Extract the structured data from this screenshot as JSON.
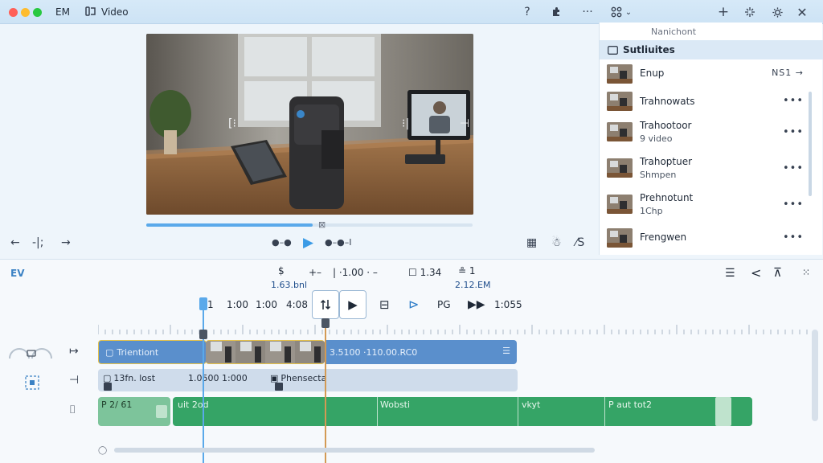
{
  "window": {
    "app_name": "EM",
    "tab_label": "Video",
    "tab_icon": "film-icon"
  },
  "toolbar": {
    "help_icon": "help-icon",
    "extension_icon": "puzzle-icon",
    "more_icon": "more-horizontal-icon",
    "layout_icon": "grid-layout-icon",
    "add_icon": "plus-icon",
    "effects_icon": "sparkle-icon",
    "settings_icon": "gear-icon",
    "close_icon": "close-icon"
  },
  "preview": {
    "progress_fraction": 0.51,
    "controls": {
      "back_label": "←",
      "split_label": "-|;",
      "forward_label": "→",
      "prev_label": "●–●",
      "next_label": "●–●–I"
    },
    "right_tools": [
      "▦",
      "☃",
      "⁄S"
    ]
  },
  "panel": {
    "caption": "Nanichont",
    "header": "Sutliuites",
    "header_icon": "folder-icon",
    "items": [
      {
        "title": "Enup",
        "sub": "",
        "trailing": "NS1 →"
      },
      {
        "title": "Trahnowats",
        "sub": "",
        "trailing": "•••"
      },
      {
        "title": "Trahootoor",
        "sub": "9 video",
        "trailing": "•••"
      },
      {
        "title": "Trahoptuer",
        "sub": "Shmpen",
        "trailing": "•••"
      },
      {
        "title": "Prehnotunt",
        "sub": "1Chp",
        "trailing": "•••"
      },
      {
        "title": "Frengwen",
        "sub": "",
        "trailing": "•••"
      }
    ]
  },
  "timeline": {
    "label": "EV",
    "tools_row1": [
      {
        "label": "$",
        "sub": "1.63.bnl"
      },
      {
        "label": "+–",
        "sub": ""
      },
      {
        "label": "|  ·1.00  · –",
        "sub": ""
      },
      {
        "label": "☐ 1.34",
        "sub": ""
      },
      {
        "label": "≗ 1",
        "sub": "2.12.EM"
      }
    ],
    "tools_row2": [
      "1",
      "1:00",
      "1:00",
      "4:08"
    ],
    "time_readout": "1:055",
    "right_tools": [
      "☰",
      "<",
      "⊼",
      "⁙"
    ],
    "tracks": [
      {
        "icon": "↦",
        "clips": [
          {
            "label": "Trientiont",
            "style": "blue"
          },
          {
            "label": "3.5100  ·110.00.RC0",
            "style": "blue"
          }
        ]
      },
      {
        "icon": "⊣",
        "clips": [
          {
            "label": "13fn. lost",
            "style": "light"
          },
          {
            "label": "1.0500 1:000",
            "style": "light"
          },
          {
            "label": "Phensecta",
            "style": "light"
          }
        ]
      },
      {
        "icon": "⌷",
        "clips": [
          {
            "label": "P 2/ 61",
            "style": "green-light"
          },
          {
            "label": "uit 2od",
            "style": "green"
          },
          {
            "label": "Wobsti",
            "style": "green"
          },
          {
            "label": "vkyt",
            "style": "green"
          },
          {
            "label": "P aut tot2",
            "style": "green"
          }
        ]
      }
    ]
  }
}
